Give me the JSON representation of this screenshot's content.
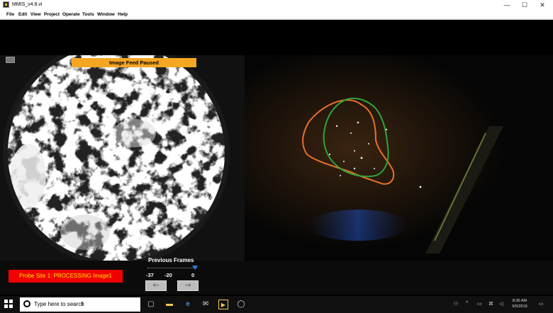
{
  "window": {
    "title": "MMIS_v4.8.vi",
    "minimize": "—",
    "maximize": "☐",
    "close": "✕"
  },
  "menu": {
    "items": [
      "File",
      "Edit",
      "View",
      "Project",
      "Operate",
      "Tools",
      "Window",
      "Help"
    ]
  },
  "probe_view": {
    "banner": "Image Feed Paused"
  },
  "status": {
    "message": "Probe Site 1: PROCESSING Image1"
  },
  "frames": {
    "label": "Previous Frames",
    "ticks": [
      "-37",
      "-20",
      "0"
    ],
    "slider_position_fraction": 0.95,
    "prev_button": "<--",
    "next_button": "-->"
  },
  "taskbar": {
    "search_placeholder": "Type here to search",
    "cursor_glyph": "I",
    "time": "8:30 AM",
    "date": "9/5/2019"
  },
  "colors": {
    "banner": "#f5a623",
    "status_bg": "#f10000",
    "status_text": "#ffe600",
    "contour_orange": "#e8702a",
    "contour_green": "#2fa33a"
  }
}
